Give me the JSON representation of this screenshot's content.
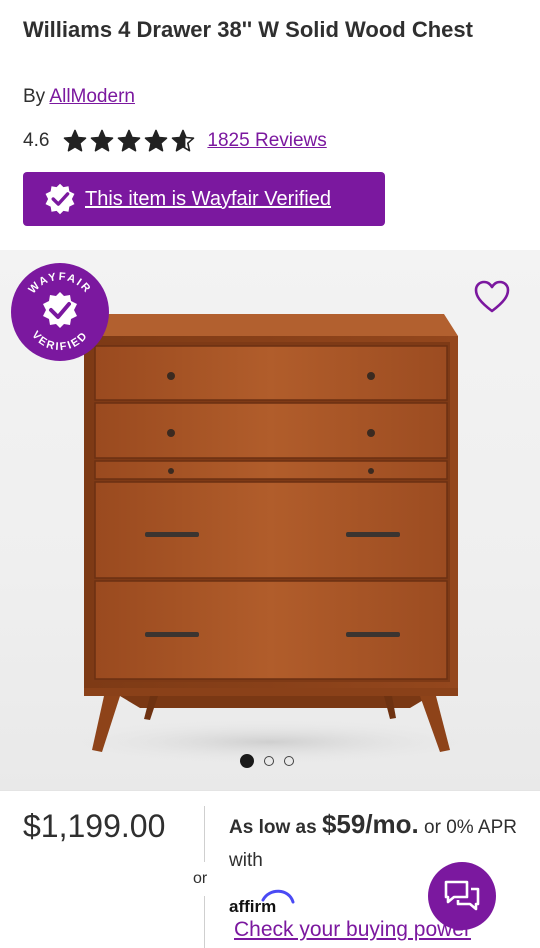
{
  "product": {
    "title": "Williams 4 Drawer 38'' W Solid Wood Chest",
    "by_prefix": "By",
    "brand": "AllModern",
    "rating": "4.6",
    "rating_value": 4.6,
    "rating_max": 5,
    "reviews_label": "1825 Reviews",
    "verified_label": "This item is Wayfair Verified"
  },
  "gallery": {
    "seal_text_top": "WAYFAIR",
    "seal_text_bottom": "VERIFIED",
    "image_count": 3,
    "active_index": 0
  },
  "pricing": {
    "price": "$1,199.00",
    "or_label": "or",
    "installment_prefix": "As low as",
    "installment_amount": "$59/mo.",
    "installment_suffix": "or 0% APR with",
    "affirm_label": "affirm",
    "buying_power_label": "Check your buying power"
  },
  "colors": {
    "accent": "#7b189f",
    "wood": "#a0522d"
  },
  "icons": {
    "wishlist": "heart-outline-icon",
    "chat": "chat-bubbles-icon",
    "verified": "verified-check-icon"
  }
}
